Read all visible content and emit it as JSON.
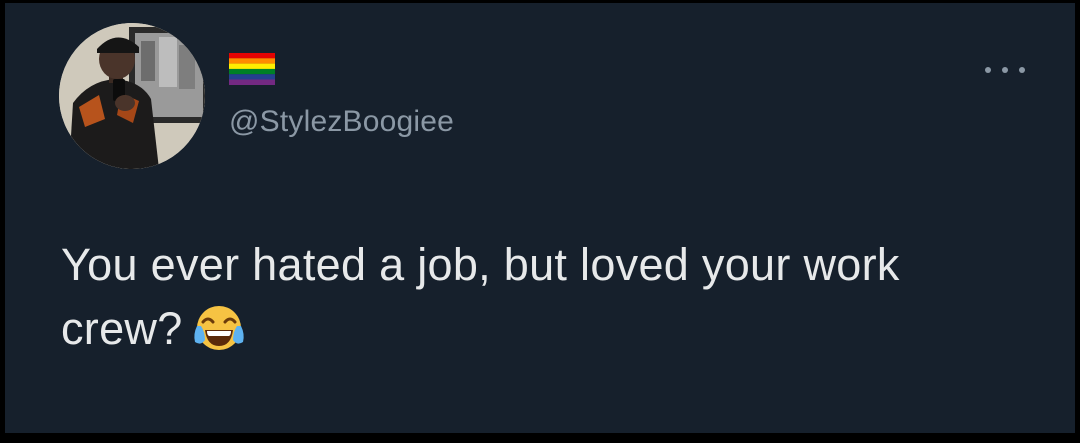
{
  "tweet": {
    "display_name_emoji": "rainbow-flag",
    "handle": "@StylezBoogiee",
    "text": "You ever hated a job, but loved your work crew?",
    "text_emoji": "face-with-tears-of-joy"
  },
  "icons": {
    "more": "more-horizontal-icon"
  },
  "colors": {
    "background": "#16202c",
    "text": "#e7e9ea",
    "muted": "#8b98a5"
  }
}
